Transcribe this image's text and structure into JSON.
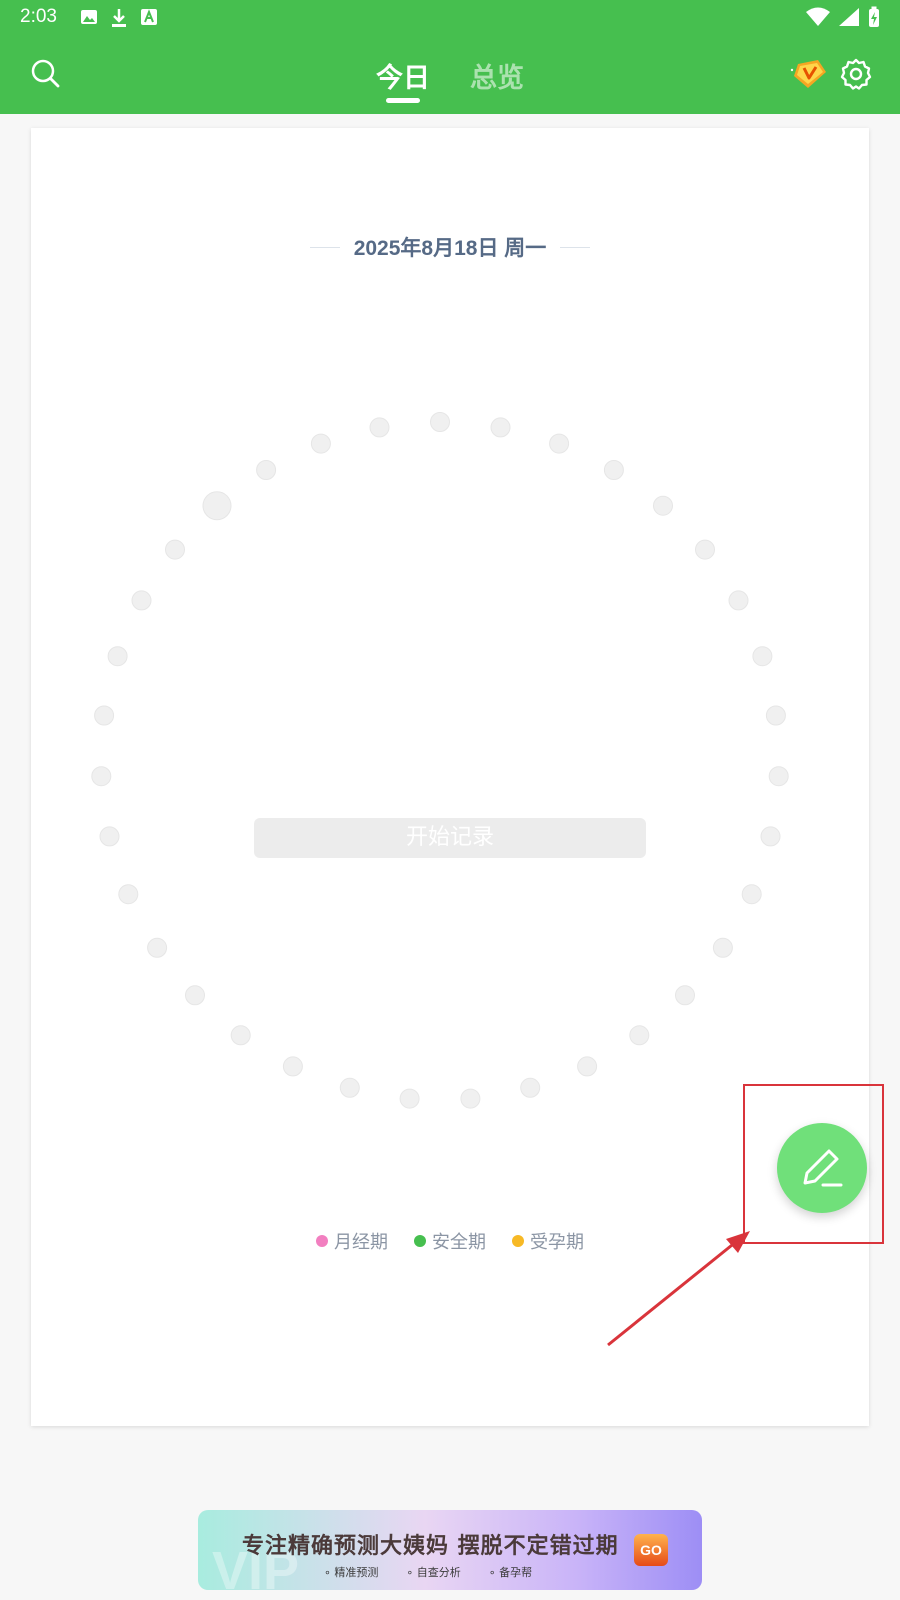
{
  "status_bar": {
    "time": "2:03",
    "left_icons": [
      "image-icon",
      "download-icon",
      "font-icon"
    ],
    "right_icons": [
      "wifi-icon",
      "signal-icon",
      "battery-charging-icon"
    ]
  },
  "header": {
    "tabs": [
      {
        "label": "今日",
        "active": true
      },
      {
        "label": "总览",
        "active": false
      }
    ],
    "icons": {
      "search": "search-icon",
      "vip": "vip-badge-icon",
      "settings": "gear-icon"
    },
    "color": "#46bf4f"
  },
  "card": {
    "date": "2025年8月18日 周一",
    "start_button": "开始记录",
    "cycle_day_count": 35,
    "current_day_index": 31,
    "legend": [
      {
        "label": "月经期",
        "color": "#f27fc0"
      },
      {
        "label": "安全期",
        "color": "#46bf4f"
      },
      {
        "label": "受孕期",
        "color": "#f7b925"
      }
    ]
  },
  "fab": {
    "icon": "pencil-icon",
    "color": "#70e07a"
  },
  "annotation": {
    "color": "#d9343b"
  },
  "ad": {
    "title": "专注精确预测大姨妈 摆脱不定错过期",
    "watermark": "VIP",
    "features": [
      "精准预测",
      "自查分析",
      "备孕帮"
    ],
    "go_label": "GO"
  }
}
